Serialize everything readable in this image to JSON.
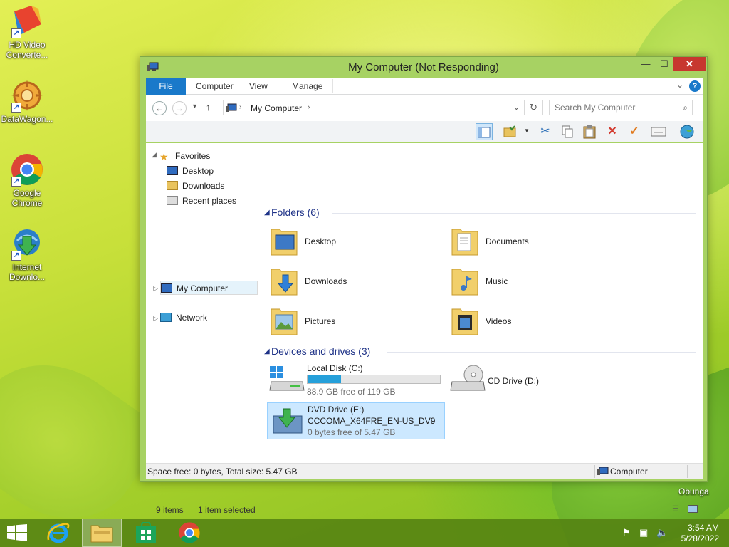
{
  "desktop": {
    "icons": [
      {
        "label": "HD Video Converte...",
        "icon": "hd-video-converter-icon"
      },
      {
        "label": "DataWagon...",
        "icon": "datawagon-icon"
      },
      {
        "label": "Google Chrome",
        "icon": "google-chrome-icon"
      },
      {
        "label": "Internet Downlo...",
        "icon": "internet-download-manager-icon"
      }
    ],
    "watermark": "Obunga"
  },
  "window": {
    "title": "My Computer (Not Responding)",
    "tabs": [
      {
        "label": "File",
        "active": true
      },
      {
        "label": "Computer"
      },
      {
        "label": "View"
      },
      {
        "label": "Manage"
      }
    ],
    "address": {
      "path": "My Computer"
    },
    "search": {
      "placeholder": "Search My Computer"
    },
    "toolbar": [
      "preview-pane-icon",
      "folder-options-icon",
      "cut-icon",
      "copy-icon",
      "paste-icon",
      "delete-icon",
      "rename-check-icon",
      "properties-icon",
      "globe-icon"
    ],
    "navpane": {
      "favorites": "Favorites",
      "favorites_items": [
        "Desktop",
        "Downloads",
        "Recent places"
      ],
      "computer": "My Computer",
      "network": "Network"
    },
    "folders_header": "Folders (6)",
    "folders": [
      {
        "name": "Desktop",
        "icon": "desktop-folder-icon"
      },
      {
        "name": "Documents",
        "icon": "documents-folder-icon"
      },
      {
        "name": "Downloads",
        "icon": "downloads-folder-icon"
      },
      {
        "name": "Music",
        "icon": "music-folder-icon"
      },
      {
        "name": "Pictures",
        "icon": "pictures-folder-icon"
      },
      {
        "name": "Videos",
        "icon": "videos-folder-icon"
      }
    ],
    "devices_header": "Devices and drives (3)",
    "drives": [
      {
        "name": "Local Disk (C:)",
        "free_text": "88.9 GB free of 119 GB",
        "used_fraction": 0.253,
        "icon": "local-disk-icon"
      },
      {
        "name": "CD Drive (D:)",
        "icon": "cd-drive-icon"
      },
      {
        "name": "DVD Drive (E:)",
        "label": "CCCOMA_X64FRE_EN-US_DV9",
        "free_text": "0 bytes free of 5.47 GB",
        "icon": "dvd-drive-icon",
        "selected": true
      }
    ],
    "item_count": "9 items",
    "selection_count": "1 item selected",
    "statusbar": {
      "space": "Space free: 0 bytes, Total size: 5.47 GB",
      "location": "Computer"
    }
  },
  "taskbar": {
    "buttons": [
      "start-button",
      "internet-explorer",
      "file-explorer",
      "store",
      "google-chrome"
    ],
    "clock": {
      "time": "3:54 AM",
      "date": "5/28/2022"
    }
  }
}
